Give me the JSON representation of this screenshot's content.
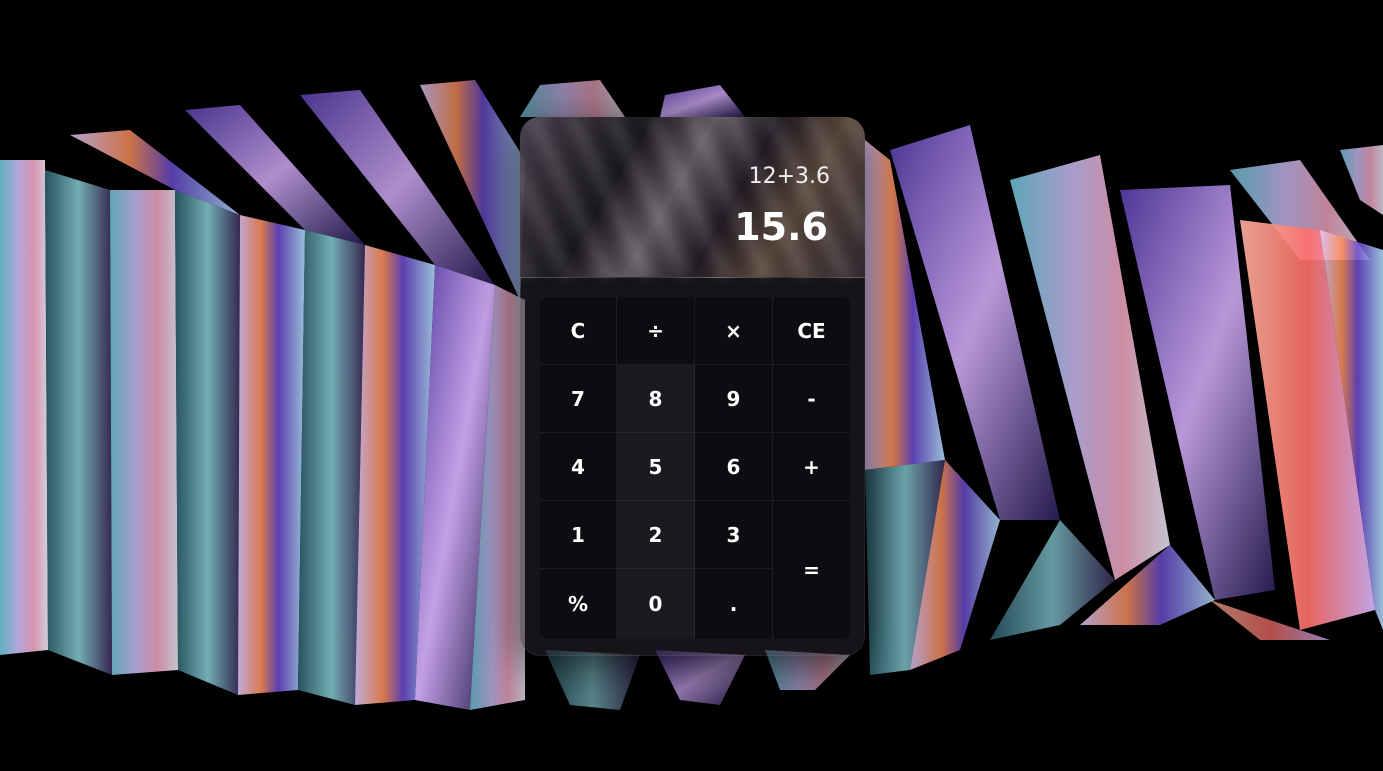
{
  "display": {
    "expression": "12+3.6",
    "result": "15.6"
  },
  "keys": {
    "clear": "C",
    "divide": "÷",
    "multiply": "×",
    "clear_entry": "CE",
    "seven": "7",
    "eight": "8",
    "nine": "9",
    "minus": "-",
    "four": "4",
    "five": "5",
    "six": "6",
    "plus": "+",
    "one": "1",
    "two": "2",
    "three": "3",
    "equals": "=",
    "percent": "%",
    "zero": "0",
    "decimal": "."
  },
  "colors": {
    "background": "#000000",
    "text": "#ffffff"
  }
}
